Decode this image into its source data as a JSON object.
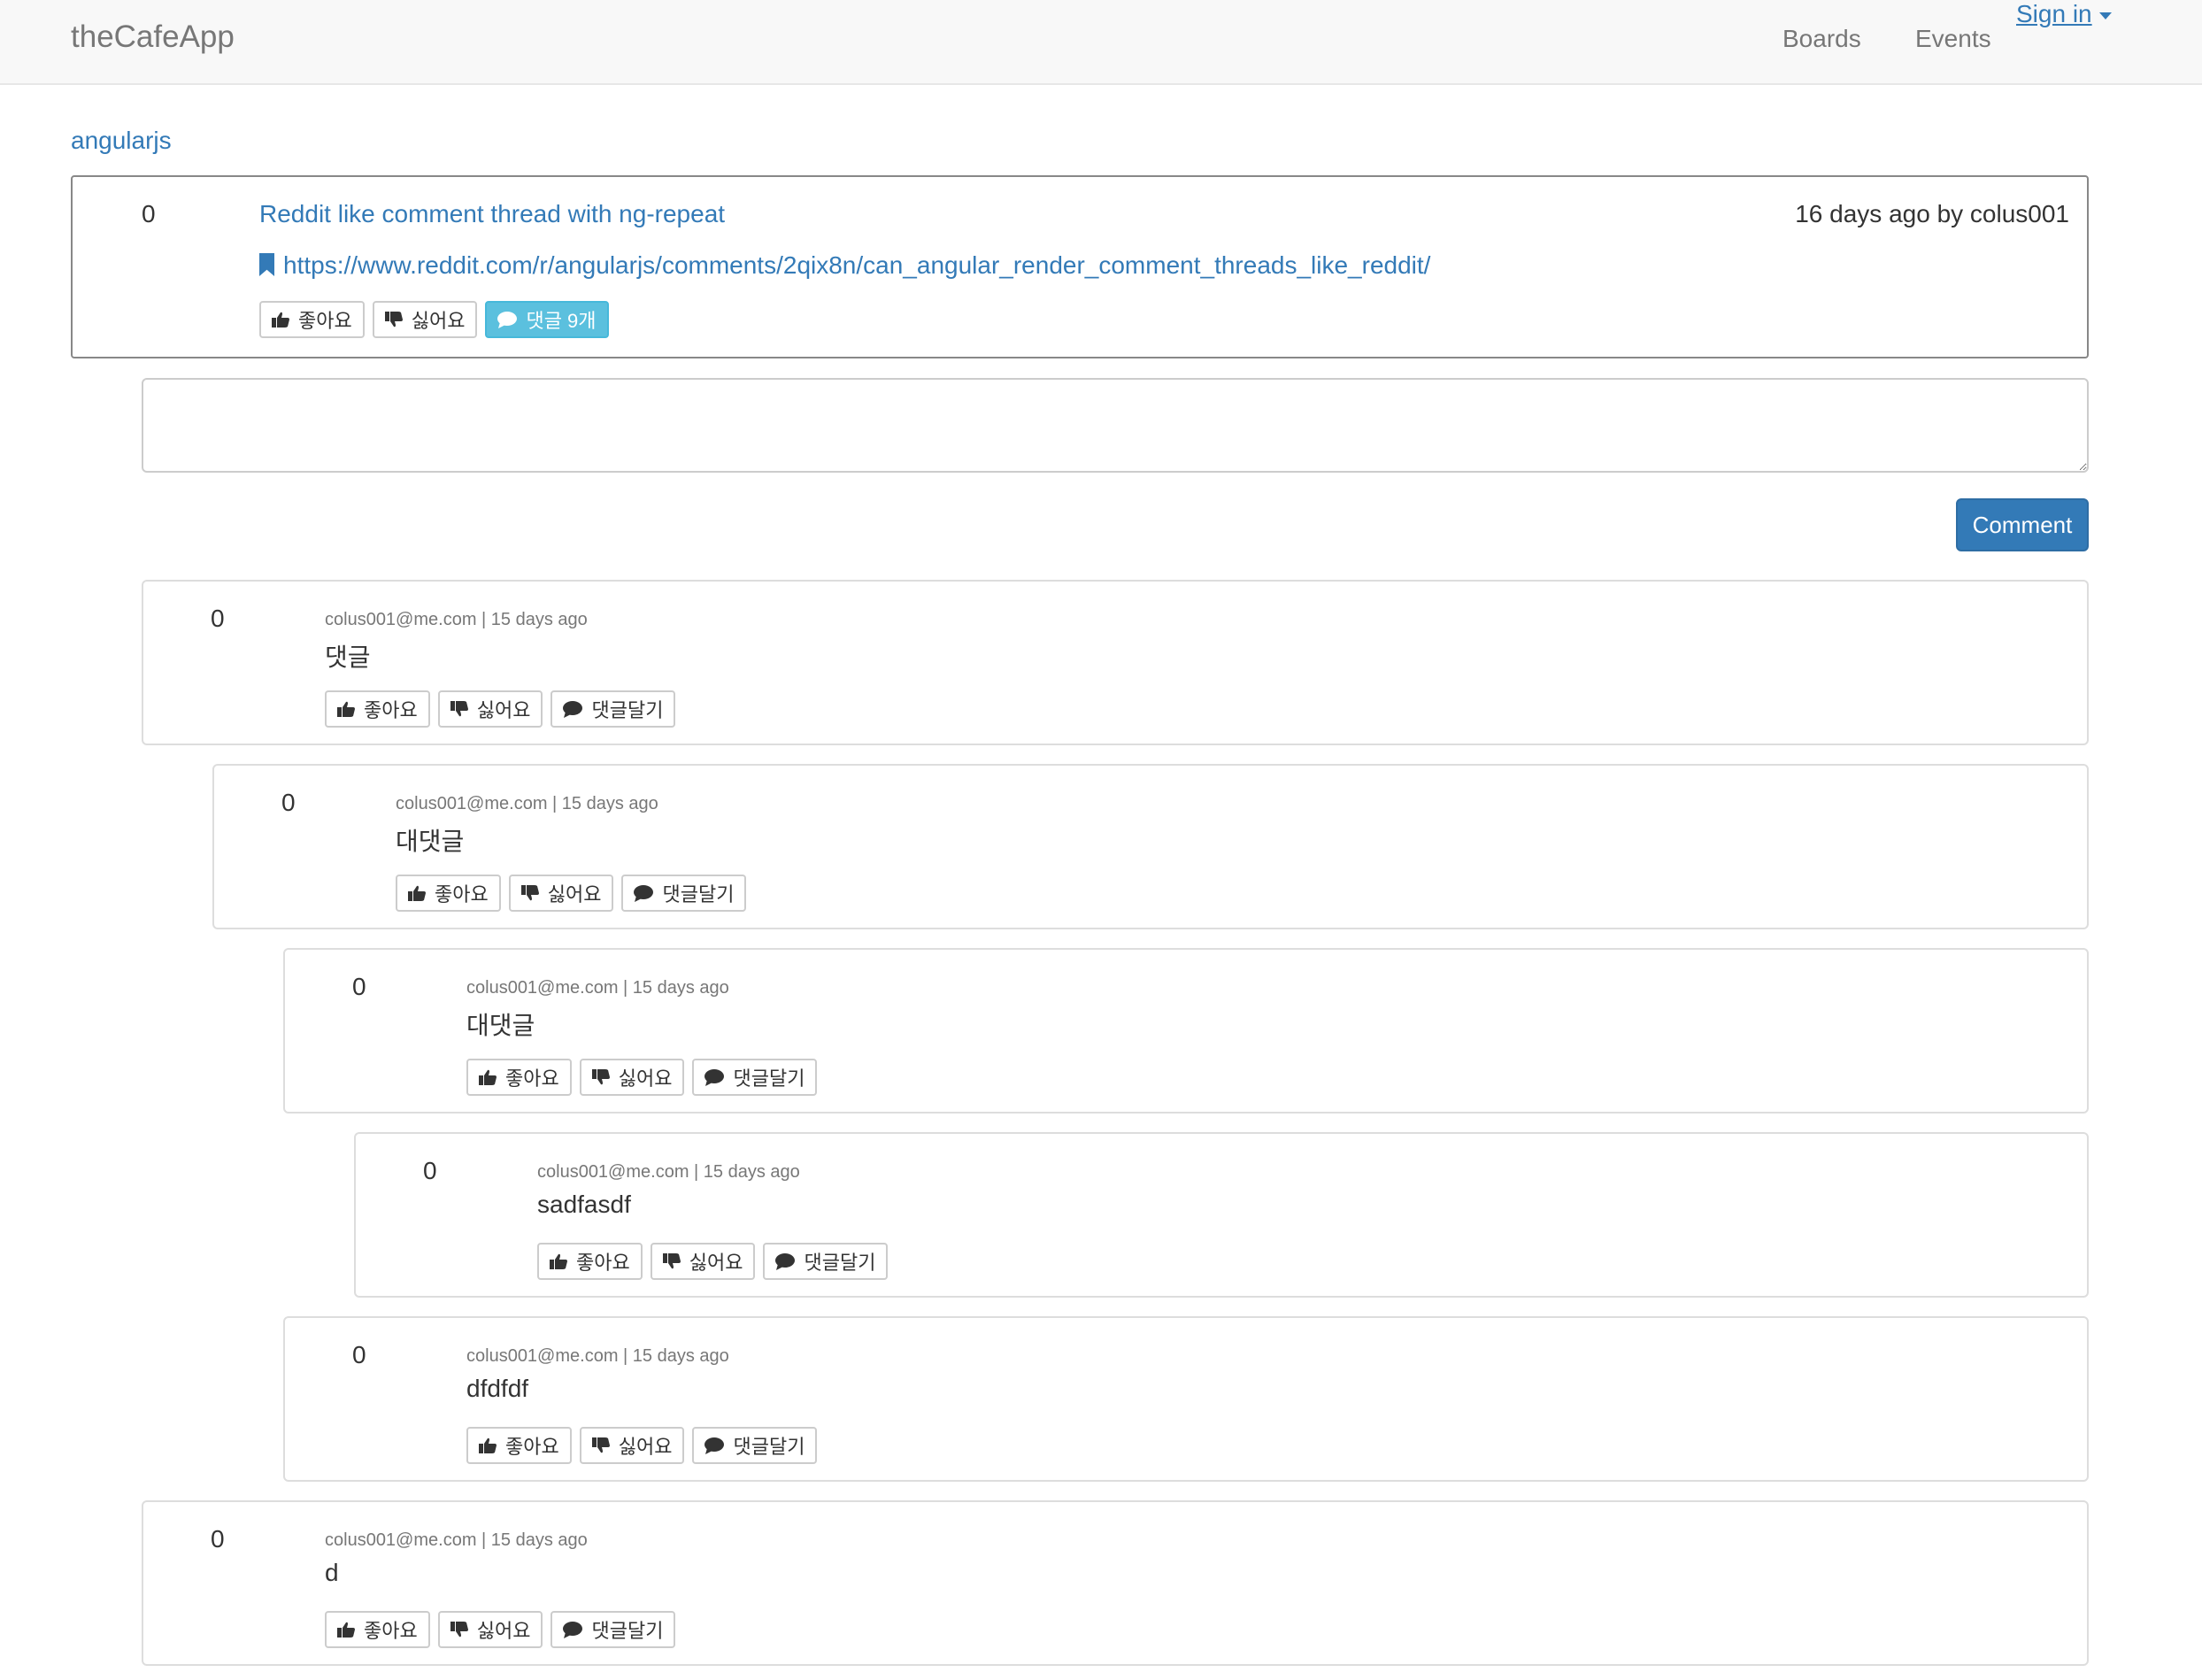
{
  "navbar": {
    "brand": "theCafeApp",
    "links": [
      "Boards",
      "Events"
    ],
    "signin": "Sign in"
  },
  "breadcrumb": "angularjs",
  "post": {
    "score": "0",
    "title": "Reddit like comment thread with ng-repeat",
    "meta": "16 days ago by colus001",
    "url": "https://www.reddit.com/r/angularjs/comments/2qix8n/can_angular_render_comment_threads_like_reddit/",
    "like_label": "좋아요",
    "dislike_label": "싫어요",
    "comments_label": "댓글 9개"
  },
  "comment_form": {
    "placeholder": "",
    "submit_label": "Comment"
  },
  "colors": {
    "link": "#337ab7",
    "info": "#5bc0de",
    "primary": "#337ab7"
  },
  "comments": [
    {
      "score": "0",
      "author": "colus001@me.com",
      "time": "15 days ago",
      "body": "댓글",
      "like": "좋아요",
      "dislike": "싫어요",
      "reply": "댓글달기",
      "depth": 0
    },
    {
      "score": "0",
      "author": "colus001@me.com",
      "time": "15 days ago",
      "body": "대댓글",
      "like": "좋아요",
      "dislike": "싫어요",
      "reply": "댓글달기",
      "depth": 1
    },
    {
      "score": "0",
      "author": "colus001@me.com",
      "time": "15 days ago",
      "body": "대댓글",
      "like": "좋아요",
      "dislike": "싫어요",
      "reply": "댓글달기",
      "depth": 2
    },
    {
      "score": "0",
      "author": "colus001@me.com",
      "time": "15 days ago",
      "body": "sadfasdf",
      "like": "좋아요",
      "dislike": "싫어요",
      "reply": "댓글달기",
      "depth": 3
    },
    {
      "score": "0",
      "author": "colus001@me.com",
      "time": "15 days ago",
      "body": "dfdfdf",
      "like": "좋아요",
      "dislike": "싫어요",
      "reply": "댓글달기",
      "depth": 2
    },
    {
      "score": "0",
      "author": "colus001@me.com",
      "time": "15 days ago",
      "body": "d",
      "like": "좋아요",
      "dislike": "싫어요",
      "reply": "댓글달기",
      "depth": 0
    }
  ]
}
